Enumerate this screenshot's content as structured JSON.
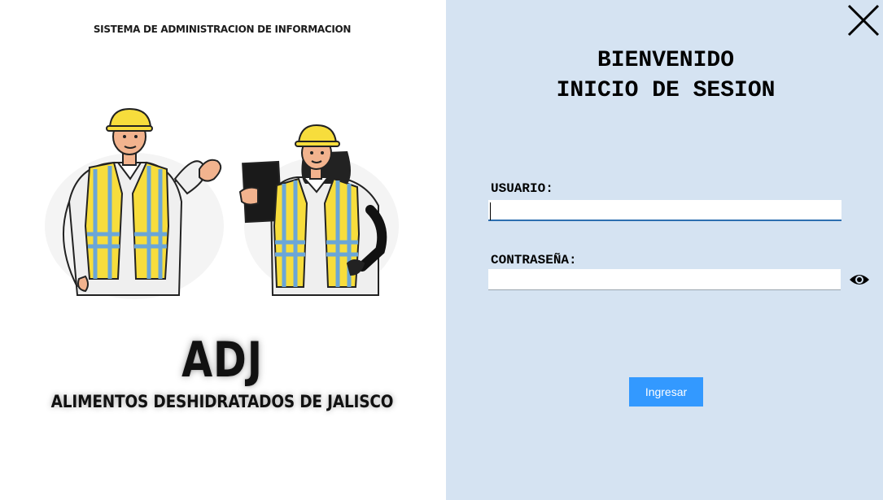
{
  "left_panel": {
    "system_title": "SISTEMA DE ADMINISTRACION DE INFORMACION",
    "brand_name": "ADJ",
    "brand_full_name": "ALIMENTOS DESHIDRATADOS DE JALISCO"
  },
  "login": {
    "welcome_line1": "BIENVENIDO",
    "welcome_line2": "INICIO DE SESION",
    "username_label": "USUARIO:",
    "username_value": "",
    "password_label": "CONTRASEÑA:",
    "password_value": "",
    "submit_label": "Ingresar"
  },
  "icons": {
    "close": "close-icon",
    "show_password": "eye-icon"
  },
  "colors": {
    "right_panel_bg": "#d5e3f2",
    "button_bg": "#3399ff",
    "vest_yellow": "#f7dd3c",
    "vest_stripe": "#6aa6d8"
  }
}
